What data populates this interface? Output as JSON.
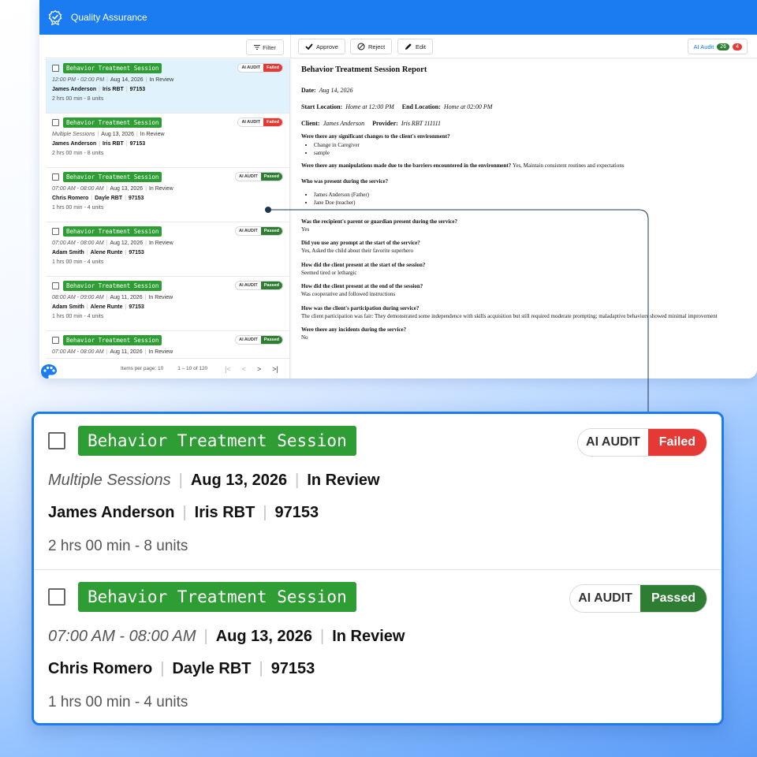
{
  "app": {
    "title": "Quality Assurance"
  },
  "toolbar": {
    "filter_label": "Filter",
    "approve_label": "Approve",
    "reject_label": "Reject",
    "edit_label": "Edit",
    "ai_audit_label": "AI Audit",
    "passed_count": "26",
    "failed_count": "4"
  },
  "list": {
    "items": [
      {
        "tag": "Behavior Treatment Session",
        "time": "12:00 PM - 02:00 PM",
        "date": "Aug 14, 2026",
        "status": "In Review",
        "client": "James Anderson",
        "provider": "Iris RBT",
        "code": "97153",
        "duration": "2 hrs 00 min - 8 units",
        "audit_label": "AI AUDIT",
        "audit_result": "Failed"
      },
      {
        "tag": "Behavior Treatment Session",
        "time": "Multiple Sessions",
        "date": "Aug 13, 2026",
        "status": "In Review",
        "client": "James Anderson",
        "provider": "Iris RBT",
        "code": "97153",
        "duration": "2 hrs 00 min - 8 units",
        "audit_label": "AI AUDIT",
        "audit_result": "Failed"
      },
      {
        "tag": "Behavior Treatment Session",
        "time": "07:00 AM - 08:00 AM",
        "date": "Aug 13, 2026",
        "status": "In Review",
        "client": "Chris Romero",
        "provider": "Dayle RBT",
        "code": "97153",
        "duration": "1 hrs 00 min - 4 units",
        "audit_label": "AI AUDIT",
        "audit_result": "Passed"
      },
      {
        "tag": "Behavior Treatment Session",
        "time": "07:00 AM - 08:00 AM",
        "date": "Aug 12, 2026",
        "status": "In Review",
        "client": "Adam Smith",
        "provider": "Alene Runte",
        "code": "97153",
        "duration": "1 hrs 00 min - 4 units",
        "audit_label": "AI AUDIT",
        "audit_result": "Passed"
      },
      {
        "tag": "Behavior Treatment Session",
        "time": "08:00 AM - 09:00 AM",
        "date": "Aug 11, 2026",
        "status": "In Review",
        "client": "Adam Smith",
        "provider": "Alene Runte",
        "code": "97153",
        "duration": "1 hrs 00 min - 4 units",
        "audit_label": "AI AUDIT",
        "audit_result": "Passed"
      },
      {
        "tag": "Behavior Treatment Session",
        "time": "07:00 AM - 08:00 AM",
        "date": "Aug 11, 2026",
        "status": "In Review",
        "audit_label": "AI AUDIT",
        "audit_result": "Passed"
      }
    ]
  },
  "pager": {
    "items_per_page_label": "Items per page:",
    "items_per_page": "10",
    "range": "1 – 10 of 120"
  },
  "report": {
    "title": "Behavior Treatment Session Report",
    "date_label": "Date:",
    "date": "Aug 14, 2026",
    "start_label": "Start Location:",
    "start_value": "Home at 12:00 PM",
    "end_label": "End Location:",
    "end_value": "Home at 02:00 PM",
    "client_label": "Client:",
    "client_value": "James Anderson",
    "provider_label": "Provider:",
    "provider_value": "Iris RBT 111111",
    "q1": "Were there any significant changes to the client's environment?",
    "q1_items": [
      "Change in Caregiver",
      "sample"
    ],
    "q2": "Were there any manipulations made due to the barriers encountered in the environment?",
    "q2_answer": "Yes, Maintain consistent routines and expectations",
    "q3": "Who was present during the service?",
    "q3_items": [
      "James Anderson (Father)",
      "Jane Doe (teacher)"
    ],
    "q4": "Was the recipient's parent or guardian present during the service?",
    "q4_answer": "Yes",
    "q5": "Did you use any prompt at the start of the service?",
    "q5_answer": "Yes, Asked the child about their favorite superhero",
    "q6": "How did the client present at the start of the session?",
    "q6_answer": "Seemed tired or lethargic",
    "q7": "How did the client present at the end of the session?",
    "q7_answer": "Was cooperative and followed instructions",
    "q8": "How was the client's participation during service?",
    "q8_answer": "The client participation was fair: They demonstrated some independence with skills acquisition but still required moderate prompting; maladaptive behaviors showed minimal improvement",
    "q9": "Were there any incidents during the service?",
    "q9_answer": "No"
  },
  "zoom": {
    "items": [
      {
        "tag": "Behavior Treatment Session",
        "time": "Multiple Sessions",
        "date": "Aug 13, 2026",
        "status": "In Review",
        "client": "James Anderson",
        "provider": "Iris RBT",
        "code": "97153",
        "duration": "2 hrs 00 min - 8 units",
        "audit_label": "AI AUDIT",
        "audit_result": "Failed"
      },
      {
        "tag": "Behavior Treatment Session",
        "time": "07:00 AM - 08:00 AM",
        "date": "Aug 13, 2026",
        "status": "In Review",
        "client": "Chris Romero",
        "provider": "Dayle RBT",
        "code": "97153",
        "duration": "1 hrs 00 min - 4 units",
        "audit_label": "AI AUDIT",
        "audit_result": "Passed"
      }
    ]
  },
  "colors": {
    "brand_blue": "#1a7cf0",
    "tag_green": "#2e9e34",
    "passed_green": "#2e7d32",
    "failed_red": "#e53935",
    "selected_row": "#e0f2fb"
  },
  "icons": [
    "badge-check-icon",
    "filter-icon",
    "check-icon",
    "block-icon",
    "pencil-icon",
    "palette-icon"
  ]
}
